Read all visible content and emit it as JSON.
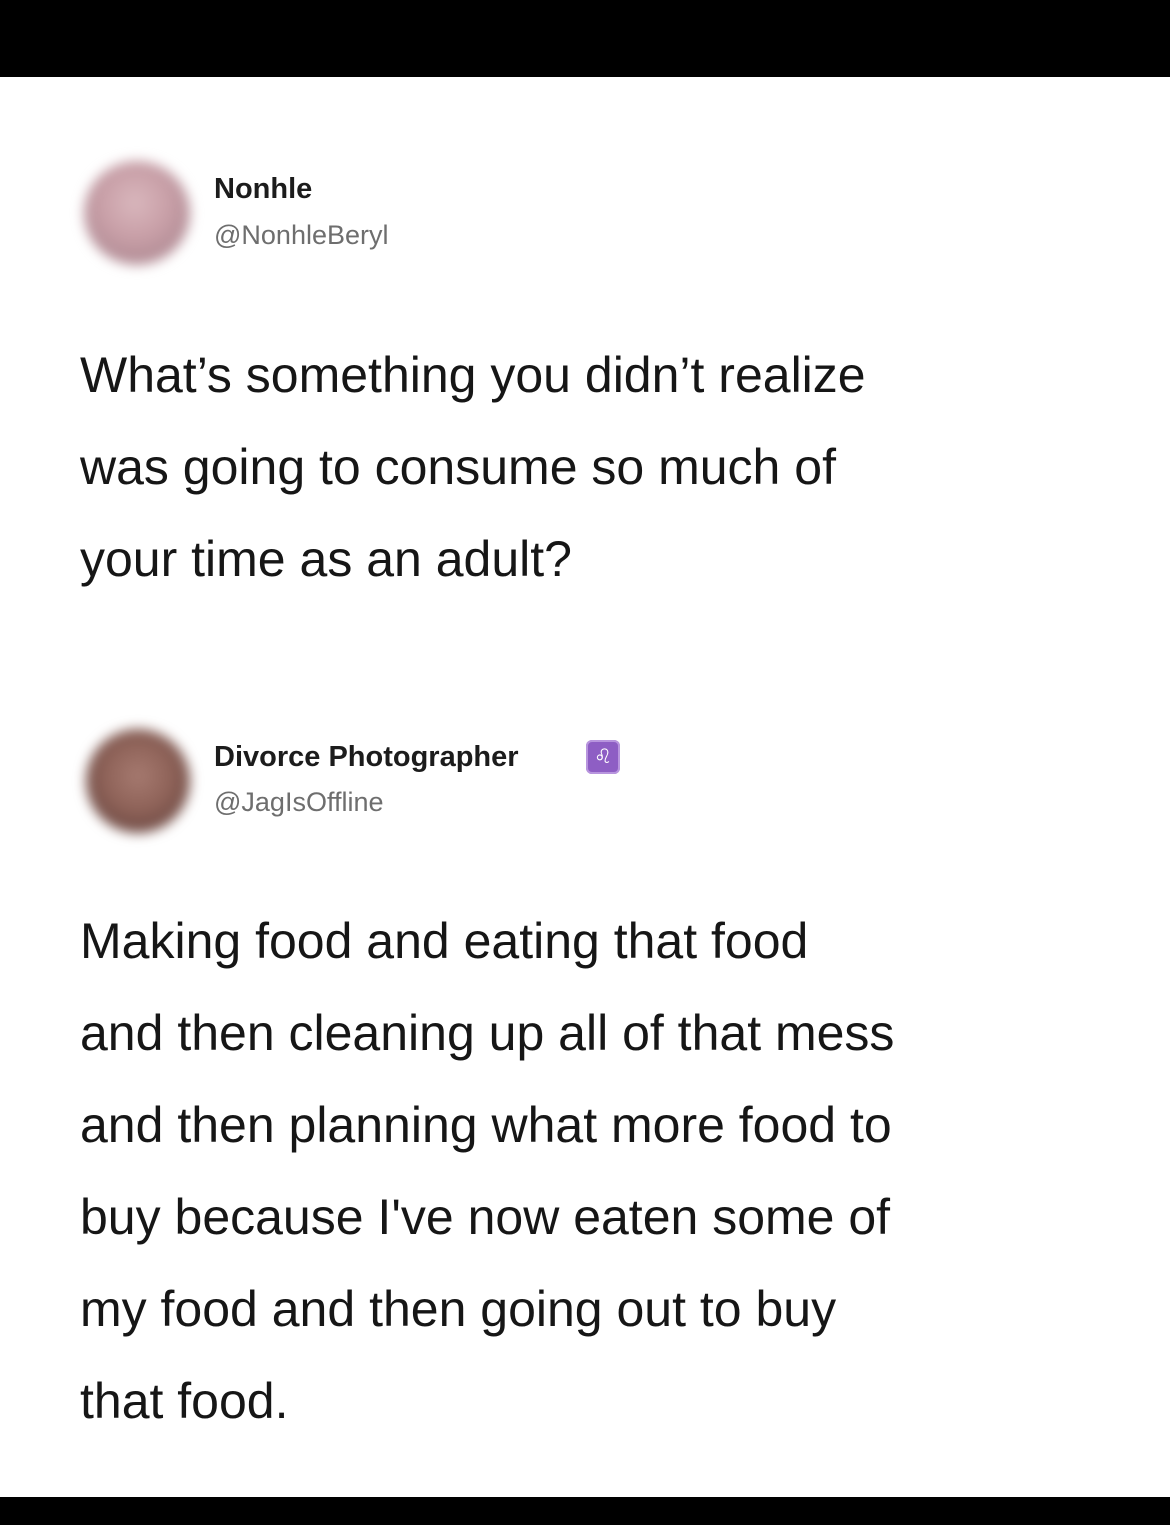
{
  "tweet1": {
    "display_name": "Nonhle",
    "handle": "@NonhleBeryl",
    "text_lines": [
      "What’s something you didn’t realize",
      "was going to consume so much of",
      "your time as an adult?"
    ]
  },
  "tweet2": {
    "display_name": "Divorce Photographer",
    "badge": "♌",
    "handle": "@JagIsOffline",
    "text_lines": [
      "Making food and eating that food",
      "and then cleaning up all of that mess",
      "and then planning what more food to",
      "buy because I've now eaten some of",
      "my food and then going out to buy",
      "that food."
    ]
  },
  "colors": {
    "background": "#ffffff",
    "frame": "#000000",
    "text": "#161616",
    "handle": "#6e6e6e",
    "badge": "#8e5ec4"
  }
}
